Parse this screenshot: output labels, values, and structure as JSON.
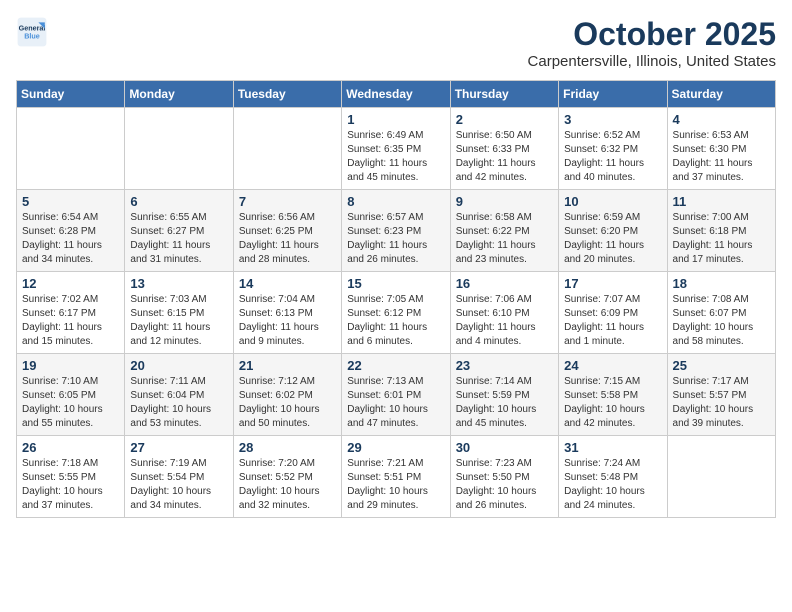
{
  "logo": {
    "line1": "General",
    "line2": "Blue"
  },
  "title": "October 2025",
  "location": "Carpentersville, Illinois, United States",
  "weekdays": [
    "Sunday",
    "Monday",
    "Tuesday",
    "Wednesday",
    "Thursday",
    "Friday",
    "Saturday"
  ],
  "weeks": [
    [
      {
        "day": "",
        "info": ""
      },
      {
        "day": "",
        "info": ""
      },
      {
        "day": "",
        "info": ""
      },
      {
        "day": "1",
        "info": "Sunrise: 6:49 AM\nSunset: 6:35 PM\nDaylight: 11 hours\nand 45 minutes."
      },
      {
        "day": "2",
        "info": "Sunrise: 6:50 AM\nSunset: 6:33 PM\nDaylight: 11 hours\nand 42 minutes."
      },
      {
        "day": "3",
        "info": "Sunrise: 6:52 AM\nSunset: 6:32 PM\nDaylight: 11 hours\nand 40 minutes."
      },
      {
        "day": "4",
        "info": "Sunrise: 6:53 AM\nSunset: 6:30 PM\nDaylight: 11 hours\nand 37 minutes."
      }
    ],
    [
      {
        "day": "5",
        "info": "Sunrise: 6:54 AM\nSunset: 6:28 PM\nDaylight: 11 hours\nand 34 minutes."
      },
      {
        "day": "6",
        "info": "Sunrise: 6:55 AM\nSunset: 6:27 PM\nDaylight: 11 hours\nand 31 minutes."
      },
      {
        "day": "7",
        "info": "Sunrise: 6:56 AM\nSunset: 6:25 PM\nDaylight: 11 hours\nand 28 minutes."
      },
      {
        "day": "8",
        "info": "Sunrise: 6:57 AM\nSunset: 6:23 PM\nDaylight: 11 hours\nand 26 minutes."
      },
      {
        "day": "9",
        "info": "Sunrise: 6:58 AM\nSunset: 6:22 PM\nDaylight: 11 hours\nand 23 minutes."
      },
      {
        "day": "10",
        "info": "Sunrise: 6:59 AM\nSunset: 6:20 PM\nDaylight: 11 hours\nand 20 minutes."
      },
      {
        "day": "11",
        "info": "Sunrise: 7:00 AM\nSunset: 6:18 PM\nDaylight: 11 hours\nand 17 minutes."
      }
    ],
    [
      {
        "day": "12",
        "info": "Sunrise: 7:02 AM\nSunset: 6:17 PM\nDaylight: 11 hours\nand 15 minutes."
      },
      {
        "day": "13",
        "info": "Sunrise: 7:03 AM\nSunset: 6:15 PM\nDaylight: 11 hours\nand 12 minutes."
      },
      {
        "day": "14",
        "info": "Sunrise: 7:04 AM\nSunset: 6:13 PM\nDaylight: 11 hours\nand 9 minutes."
      },
      {
        "day": "15",
        "info": "Sunrise: 7:05 AM\nSunset: 6:12 PM\nDaylight: 11 hours\nand 6 minutes."
      },
      {
        "day": "16",
        "info": "Sunrise: 7:06 AM\nSunset: 6:10 PM\nDaylight: 11 hours\nand 4 minutes."
      },
      {
        "day": "17",
        "info": "Sunrise: 7:07 AM\nSunset: 6:09 PM\nDaylight: 11 hours\nand 1 minute."
      },
      {
        "day": "18",
        "info": "Sunrise: 7:08 AM\nSunset: 6:07 PM\nDaylight: 10 hours\nand 58 minutes."
      }
    ],
    [
      {
        "day": "19",
        "info": "Sunrise: 7:10 AM\nSunset: 6:05 PM\nDaylight: 10 hours\nand 55 minutes."
      },
      {
        "day": "20",
        "info": "Sunrise: 7:11 AM\nSunset: 6:04 PM\nDaylight: 10 hours\nand 53 minutes."
      },
      {
        "day": "21",
        "info": "Sunrise: 7:12 AM\nSunset: 6:02 PM\nDaylight: 10 hours\nand 50 minutes."
      },
      {
        "day": "22",
        "info": "Sunrise: 7:13 AM\nSunset: 6:01 PM\nDaylight: 10 hours\nand 47 minutes."
      },
      {
        "day": "23",
        "info": "Sunrise: 7:14 AM\nSunset: 5:59 PM\nDaylight: 10 hours\nand 45 minutes."
      },
      {
        "day": "24",
        "info": "Sunrise: 7:15 AM\nSunset: 5:58 PM\nDaylight: 10 hours\nand 42 minutes."
      },
      {
        "day": "25",
        "info": "Sunrise: 7:17 AM\nSunset: 5:57 PM\nDaylight: 10 hours\nand 39 minutes."
      }
    ],
    [
      {
        "day": "26",
        "info": "Sunrise: 7:18 AM\nSunset: 5:55 PM\nDaylight: 10 hours\nand 37 minutes."
      },
      {
        "day": "27",
        "info": "Sunrise: 7:19 AM\nSunset: 5:54 PM\nDaylight: 10 hours\nand 34 minutes."
      },
      {
        "day": "28",
        "info": "Sunrise: 7:20 AM\nSunset: 5:52 PM\nDaylight: 10 hours\nand 32 minutes."
      },
      {
        "day": "29",
        "info": "Sunrise: 7:21 AM\nSunset: 5:51 PM\nDaylight: 10 hours\nand 29 minutes."
      },
      {
        "day": "30",
        "info": "Sunrise: 7:23 AM\nSunset: 5:50 PM\nDaylight: 10 hours\nand 26 minutes."
      },
      {
        "day": "31",
        "info": "Sunrise: 7:24 AM\nSunset: 5:48 PM\nDaylight: 10 hours\nand 24 minutes."
      },
      {
        "day": "",
        "info": ""
      }
    ]
  ]
}
